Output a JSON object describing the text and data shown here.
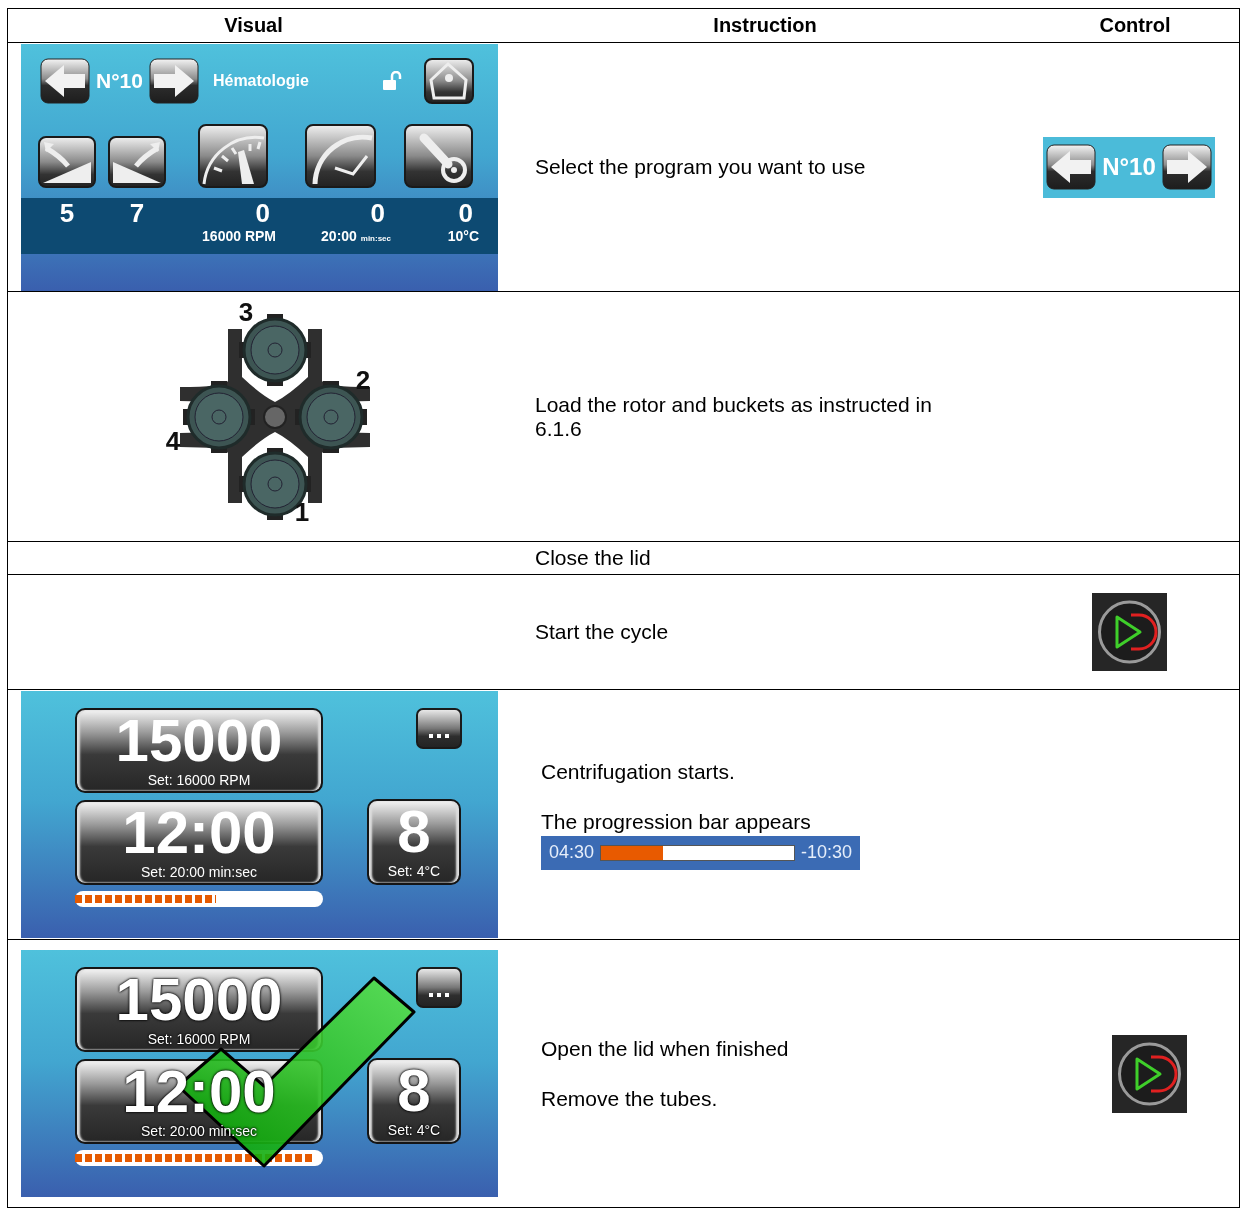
{
  "columns": [
    "Visual",
    "Instruction",
    "Control"
  ],
  "rows": [
    {
      "visual": {
        "kind": "home_screen",
        "program": "N°10",
        "name": "Hématologie",
        "unlocked": true,
        "acceleration": "5",
        "deceleration": "7",
        "speed": "0",
        "speed_set": "16000 RPM",
        "time": "0",
        "time_set": "20:00",
        "time_unit": "min:sec",
        "temp": "0",
        "temp_set": "10°C"
      },
      "instructions": [
        "Select the program you want to use"
      ],
      "control": {
        "kind": "program_selector",
        "program": "N°10"
      }
    },
    {
      "visual": {
        "kind": "rotor",
        "bucket_numbers": [
          "3",
          "2",
          "4",
          "1"
        ]
      },
      "instructions": [
        "Load the rotor and buckets as instructed in 6.1.6"
      ]
    },
    {
      "instructions": [
        "Close the lid"
      ]
    },
    {
      "instructions": [
        "Start the cycle"
      ],
      "control": {
        "kind": "start_button"
      }
    },
    {
      "visual": {
        "kind": "run_screen",
        "finished": false,
        "speed": "15000",
        "speed_set": "Set: 16000 RPM",
        "time": "12:00",
        "time_set": "Set: 20:00 min:sec",
        "temp": "8",
        "temp_set": "Set: 4°C",
        "level": 0.57
      },
      "instructions": [
        "Centrifugation starts.",
        "The progression bar  appears"
      ],
      "progress": {
        "elapsed": "04:30",
        "remaining": "-10:30",
        "level": 0.32
      }
    },
    {
      "visual": {
        "kind": "run_screen",
        "finished": true,
        "speed": "15000",
        "speed_set": "Set: 16000 RPM",
        "time": "12:00",
        "time_set": "Set: 20:00 min:sec",
        "temp": "8",
        "temp_set": "Set: 4°C",
        "level": 0.96
      },
      "instructions": [
        "Open the lid when finished",
        "Remove the tubes."
      ],
      "control": {
        "kind": "start_button"
      }
    }
  ]
}
